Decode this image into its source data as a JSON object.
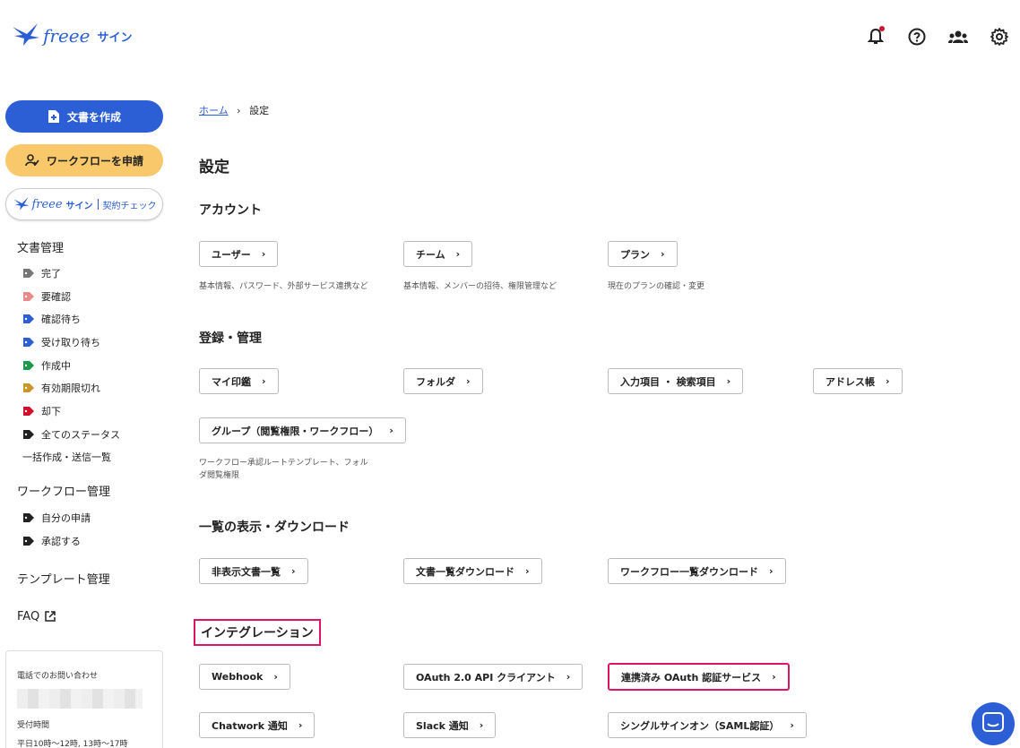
{
  "header": {
    "logo_text": "freee",
    "logo_sub": "サイン"
  },
  "sidebar": {
    "create_doc": "文書を作成",
    "apply_workflow": "ワークフローを申請",
    "check_logo": "freee",
    "check_sub": "サイン",
    "check_label": "契約チェック",
    "doc_mgmt": "文書管理",
    "statuses": [
      {
        "label": "完了",
        "color": "#777777"
      },
      {
        "label": "要確認",
        "color": "#e88a8a"
      },
      {
        "label": "確認待ち",
        "color": "#2c5fd6"
      },
      {
        "label": "受け取り待ち",
        "color": "#2c5fd6"
      },
      {
        "label": "作成中",
        "color": "#1a9a4a"
      },
      {
        "label": "有効期限切れ",
        "color": "#c9962a"
      },
      {
        "label": "却下",
        "color": "#d0102d"
      },
      {
        "label": "全てのステータス",
        "color": "#222222"
      }
    ],
    "bulk": "一括作成・送信一覧",
    "workflow_mgmt": "ワークフロー管理",
    "wf_items": [
      "自分の申請",
      "承認する"
    ],
    "template_mgmt": "テンプレート管理",
    "faq": "FAQ",
    "contact_title": "電話でのお問い合わせ",
    "hours_title": "受付時間",
    "hours": "平日10時〜12時, 13時〜17時"
  },
  "breadcrumb": {
    "home": "ホーム",
    "current": "設定"
  },
  "page_title": "設定",
  "account": {
    "title": "アカウント",
    "buttons": [
      "ユーザー",
      "チーム",
      "プラン"
    ],
    "descs": [
      "基本情報、パスワード、外部サービス連携など",
      "基本情報、メンバーの招待、権限管理など",
      "現在のプランの確認・変更"
    ]
  },
  "register": {
    "title": "登録・管理",
    "buttons": [
      "マイ印鑑",
      "フォルダ",
      "入力項目 ・ 検索項目",
      "アドレス帳",
      "グループ（閲覧権限・ワークフロー）"
    ],
    "group_desc_1": "ワークフロー承認ルートテンプレート、フォル",
    "group_desc_2": "ダ閲覧権限"
  },
  "listing": {
    "title": "一覧の表示・ダウンロード",
    "buttons": [
      "非表示文書一覧",
      "文書一覧ダウンロード",
      "ワークフロー一覧ダウンロード"
    ]
  },
  "integration": {
    "title": "インテグレーション",
    "buttons": [
      "Webhook",
      "OAuth 2.0 API クライアント",
      "連携済み OAuth 認証サービス",
      "Chatwork 通知",
      "Slack 通知",
      "シングルサインオン（SAML認証）"
    ]
  },
  "chevron": "›"
}
